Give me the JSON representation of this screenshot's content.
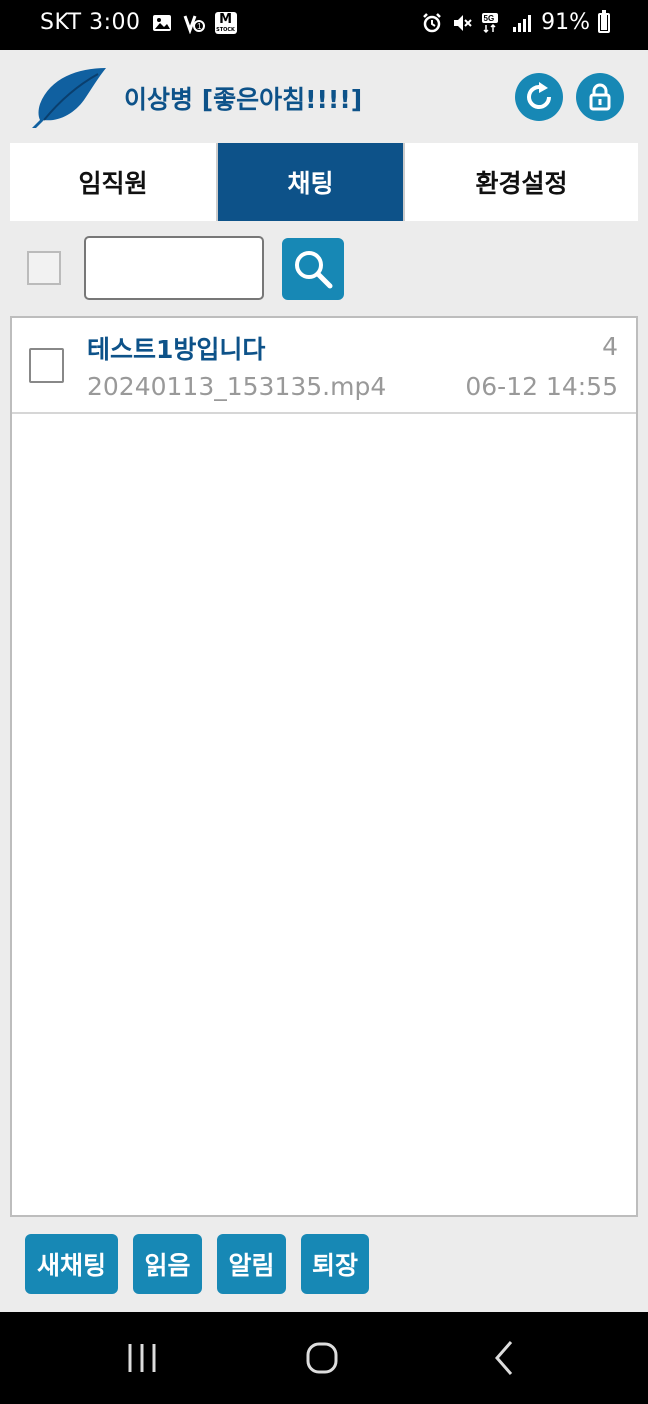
{
  "status_bar": {
    "carrier_time": "SKT 3:00",
    "mstock_label": "M",
    "mstock_sub": "STOCK",
    "network": "5G",
    "battery": "91%",
    "battery_level": 0.91
  },
  "header": {
    "user_title": "이상병 [좋은아침!!!!]"
  },
  "tabs": [
    {
      "label": "임직원",
      "active": false
    },
    {
      "label": "채팅",
      "active": true
    },
    {
      "label": "환경설정",
      "active": false
    }
  ],
  "search": {
    "value": "",
    "placeholder": ""
  },
  "rooms": [
    {
      "name": "테스트1방입니다",
      "count": "4",
      "last_message": "20240113_153135.mp4",
      "time": "06-12 14:55"
    }
  ],
  "actions": {
    "new_chat": "새채팅",
    "read": "읽음",
    "alert": "알림",
    "leave": "퇴장"
  },
  "colors": {
    "primary": "#0d5289",
    "accent": "#1788b5",
    "background": "#ececec"
  }
}
